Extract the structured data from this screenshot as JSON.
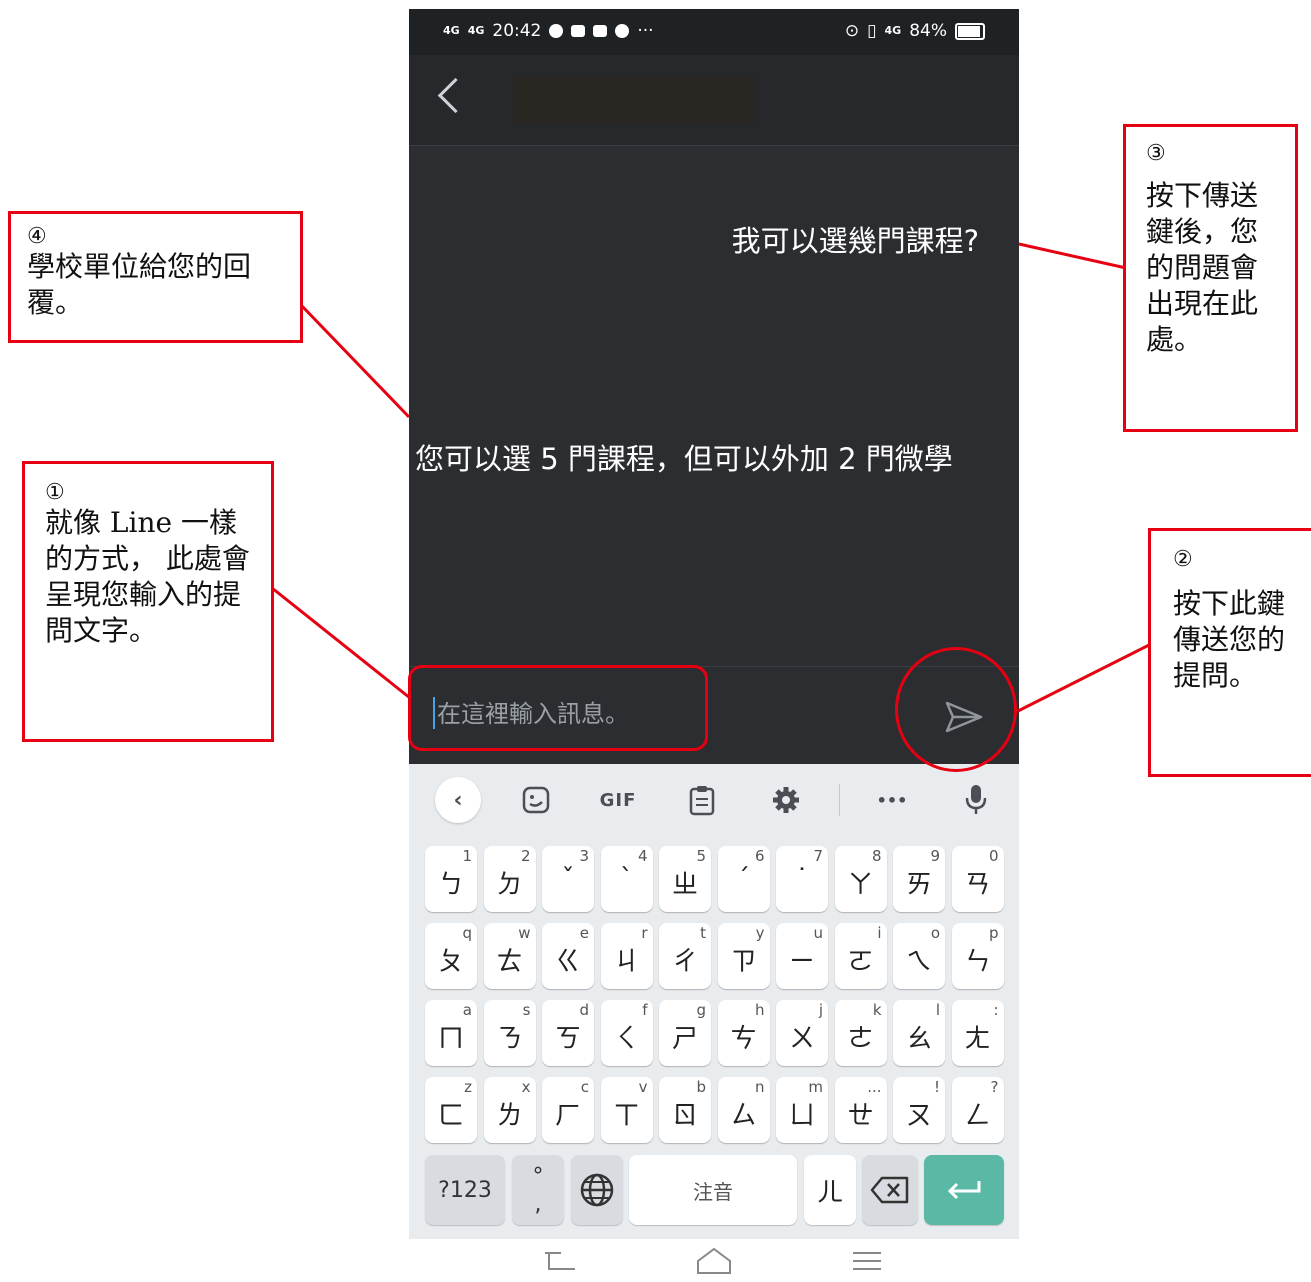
{
  "status_bar": {
    "signal_1": "4G",
    "signal_2": "4G",
    "time": "20:42",
    "network": "4G",
    "battery": "84%",
    "more": "···"
  },
  "chat": {
    "user_message": "我可以選幾門課程?",
    "reply_message": "您可以選 5 門課程，但可以外加 2 門微學"
  },
  "input": {
    "placeholder": "在這裡輸入訊息。"
  },
  "keyboard": {
    "toolbar": {
      "gif": "GIF",
      "more": "•••"
    },
    "rows": [
      [
        {
          "m": "ㄅ",
          "h": "1"
        },
        {
          "m": "ㄉ",
          "h": "2"
        },
        {
          "m": "ˇ",
          "h": "3"
        },
        {
          "m": "ˋ",
          "h": "4"
        },
        {
          "m": "ㄓ",
          "h": "5"
        },
        {
          "m": "ˊ",
          "h": "6"
        },
        {
          "m": "˙",
          "h": "7"
        },
        {
          "m": "ㄚ",
          "h": "8"
        },
        {
          "m": "ㄞ",
          "h": "9"
        },
        {
          "m": "ㄢ",
          "h": "0"
        }
      ],
      [
        {
          "m": "ㄆ",
          "h": "q"
        },
        {
          "m": "ㄊ",
          "h": "w"
        },
        {
          "m": "ㄍ",
          "h": "e"
        },
        {
          "m": "ㄐ",
          "h": "r"
        },
        {
          "m": "ㄔ",
          "h": "t"
        },
        {
          "m": "ㄗ",
          "h": "y"
        },
        {
          "m": "ㄧ",
          "h": "u"
        },
        {
          "m": "ㄛ",
          "h": "i"
        },
        {
          "m": "ㄟ",
          "h": "o"
        },
        {
          "m": "ㄣ",
          "h": "p"
        }
      ],
      [
        {
          "m": "ㄇ",
          "h": "a"
        },
        {
          "m": "ㄋ",
          "h": "s"
        },
        {
          "m": "ㄎ",
          "h": "d"
        },
        {
          "m": "ㄑ",
          "h": "f"
        },
        {
          "m": "ㄕ",
          "h": "g"
        },
        {
          "m": "ㄘ",
          "h": "h"
        },
        {
          "m": "ㄨ",
          "h": "j"
        },
        {
          "m": "ㄜ",
          "h": "k"
        },
        {
          "m": "ㄠ",
          "h": "l"
        },
        {
          "m": "ㄤ",
          "h": ":"
        }
      ],
      [
        {
          "m": "ㄈ",
          "h": "z"
        },
        {
          "m": "ㄌ",
          "h": "x"
        },
        {
          "m": "ㄏ",
          "h": "c"
        },
        {
          "m": "ㄒ",
          "h": "v"
        },
        {
          "m": "ㄖ",
          "h": "b"
        },
        {
          "m": "ㄙ",
          "h": "n"
        },
        {
          "m": "ㄩ",
          "h": "m"
        },
        {
          "m": "ㄝ",
          "h": "..."
        },
        {
          "m": "ㄡ",
          "h": "!"
        },
        {
          "m": "ㄥ",
          "h": "?"
        }
      ]
    ],
    "key_123": "?123",
    "key_punct_top": "°",
    "key_punct_bottom": ",",
    "key_space": "注音",
    "key_er": "ㄦ"
  },
  "annotations": {
    "c1": {
      "num": "①",
      "text": "就像 Line 一樣的方式， 此處會呈現您輸入的提問文字。"
    },
    "c2": {
      "num": "②",
      "text": "按下此鍵傳送您的提問。"
    },
    "c3": {
      "num": "③",
      "text": "按下傳送鍵後，您的問題會出現在此處。"
    },
    "c4": {
      "num": "④",
      "text": "學校單位給您的回覆。"
    },
    "color": "#e60012"
  },
  "colors": {
    "chat_bg": "#2b2d30",
    "header_bg": "#26282b",
    "keyboard_bg": "#e9ecef",
    "enter_key": "#5ab9a4"
  }
}
